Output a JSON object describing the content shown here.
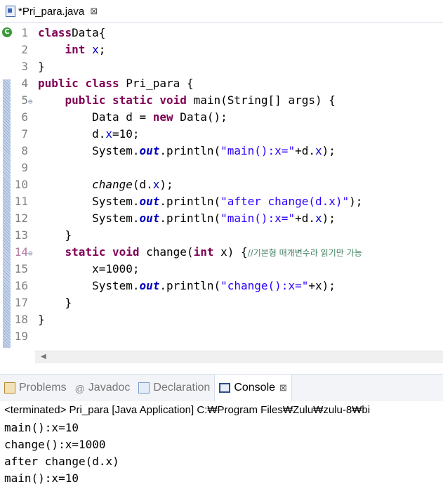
{
  "editor_tab": {
    "title": "*Pri_para.java",
    "close": "⊠"
  },
  "code_lines": [
    {
      "n": "1",
      "t": [
        [
          "kw",
          "class"
        ],
        [
          "",
          "Data{"
        ]
      ]
    },
    {
      "n": "2",
      "t": [
        [
          "",
          "    "
        ],
        [
          "kw",
          "int"
        ],
        [
          "",
          ""
        ],
        [
          "fld",
          " x"
        ],
        [
          "",
          ";"
        ]
      ]
    },
    {
      "n": "3",
      "t": [
        [
          "",
          "}"
        ]
      ]
    },
    {
      "n": "4",
      "t": [
        [
          "kw",
          "public"
        ],
        [
          "",
          " "
        ],
        [
          "kw",
          "class"
        ],
        [
          "",
          " Pri_para {"
        ]
      ]
    },
    {
      "n": "5",
      "t": [
        [
          "",
          "    "
        ],
        [
          "kw",
          "public"
        ],
        [
          "",
          " "
        ],
        [
          "kw",
          "static"
        ],
        [
          "",
          " "
        ],
        [
          "kw",
          "void"
        ],
        [
          "",
          " main(String[] "
        ],
        [
          "",
          "args) {"
        ]
      ]
    },
    {
      "n": "6",
      "t": [
        [
          "",
          "        Data d = "
        ],
        [
          "kw",
          "new"
        ],
        [
          "",
          " Data();"
        ]
      ]
    },
    {
      "n": "7",
      "t": [
        [
          "",
          "        d."
        ],
        [
          "fld",
          "x"
        ],
        [
          "",
          "=10;"
        ]
      ]
    },
    {
      "n": "8",
      "t": [
        [
          "",
          "        System."
        ],
        [
          "sfld",
          "out"
        ],
        [
          "",
          ".println("
        ],
        [
          "str",
          "\"main():x=\""
        ],
        [
          "",
          "+d."
        ],
        [
          "fld",
          "x"
        ],
        [
          "",
          ");"
        ]
      ]
    },
    {
      "n": "9",
      "t": [
        [
          "",
          ""
        ]
      ]
    },
    {
      "n": "10",
      "t": [
        [
          "",
          "        "
        ],
        [
          "it",
          "change"
        ],
        [
          "",
          "(d."
        ],
        [
          "fld",
          "x"
        ],
        [
          "",
          ");"
        ]
      ]
    },
    {
      "n": "11",
      "t": [
        [
          "",
          "        System."
        ],
        [
          "sfld",
          "out"
        ],
        [
          "",
          ".println("
        ],
        [
          "str",
          "\"after change(d.x)\""
        ],
        [
          "",
          ");"
        ]
      ]
    },
    {
      "n": "12",
      "t": [
        [
          "",
          "        System."
        ],
        [
          "sfld",
          "out"
        ],
        [
          "",
          ".println("
        ],
        [
          "str",
          "\"main():x=\""
        ],
        [
          "",
          "+d."
        ],
        [
          "fld",
          "x"
        ],
        [
          "",
          ");"
        ]
      ]
    },
    {
      "n": "13",
      "t": [
        [
          "",
          "    }"
        ]
      ]
    },
    {
      "n": "14",
      "t": [
        [
          "",
          "    "
        ],
        [
          "kw",
          "static"
        ],
        [
          "",
          " "
        ],
        [
          "kw",
          "void"
        ],
        [
          "",
          " change("
        ],
        [
          "kw",
          "int"
        ],
        [
          "",
          " x) {"
        ],
        [
          "cmt",
          "//기본형 매개변수라 읽기만 가능"
        ]
      ]
    },
    {
      "n": "15",
      "t": [
        [
          "",
          "        x=1000;"
        ]
      ]
    },
    {
      "n": "16",
      "t": [
        [
          "",
          "        System."
        ],
        [
          "sfld",
          "out"
        ],
        [
          "",
          ".println("
        ],
        [
          "str",
          "\"change():x=\""
        ],
        [
          "",
          "+x);"
        ]
      ]
    },
    {
      "n": "17",
      "t": [
        [
          "",
          "    }"
        ]
      ]
    },
    {
      "n": "18",
      "t": [
        [
          "",
          "}"
        ]
      ]
    },
    {
      "n": "19",
      "t": [
        [
          "",
          ""
        ]
      ]
    }
  ],
  "panel": {
    "tabs": [
      {
        "label": "Problems",
        "icon": "problems-icon",
        "active": false
      },
      {
        "label": "Javadoc",
        "icon": "javadoc-icon",
        "active": false
      },
      {
        "label": "Declaration",
        "icon": "declaration-icon",
        "active": false
      },
      {
        "label": "Console",
        "icon": "console-icon",
        "active": true
      }
    ],
    "close": "⊠"
  },
  "console": {
    "terminated": "<terminated> Pri_para [Java Application] C:₩Program Files₩Zulu₩zulu-8₩bi",
    "output": [
      "main():x=10",
      "change():x=1000",
      "after change(d.x)",
      "main():x=10"
    ]
  },
  "colors": {
    "keyword": "#7f0055",
    "field": "#0000c0",
    "string": "#2a00ff",
    "comment": "#3f7f5f"
  }
}
